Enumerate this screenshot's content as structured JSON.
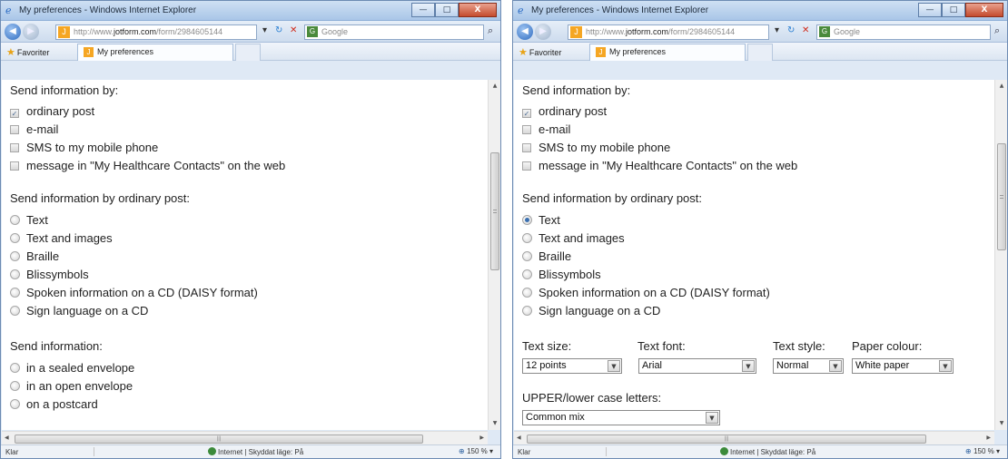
{
  "colors": {
    "titlebar": "#a9c6e8",
    "close": "#c44b2d",
    "checked": "#3a6fb0"
  },
  "left": {
    "window": {
      "title": "My preferences - Windows Internet Explorer",
      "minimize": "—",
      "maximize": "□",
      "close": "X"
    },
    "nav": {
      "url_prefix": "http://www.",
      "url_domain": "jotform.com",
      "url_path": "/form/2984605144",
      "search_placeholder": "Google"
    },
    "favorites_label": "Favoriter",
    "tab_label": "My preferences",
    "send_by": {
      "title": "Send information by:",
      "options": [
        {
          "label": "ordinary post",
          "checked": true
        },
        {
          "label": "e-mail",
          "checked": false
        },
        {
          "label": "SMS to my mobile phone",
          "checked": false
        },
        {
          "label": "message in \"My Healthcare Contacts\" on the web",
          "checked": false
        }
      ]
    },
    "post_format": {
      "title": "Send information by ordinary post:",
      "options": [
        {
          "label": "Text",
          "selected": false
        },
        {
          "label": "Text and images",
          "selected": false
        },
        {
          "label": "Braille",
          "selected": false
        },
        {
          "label": "Blissymbols",
          "selected": false
        },
        {
          "label": "Spoken information on a CD (DAISY format)",
          "selected": false
        },
        {
          "label": "Sign language on a CD",
          "selected": false
        }
      ]
    },
    "envelope": {
      "title": "Send information:",
      "options": [
        {
          "label": "in a sealed envelope",
          "selected": false
        },
        {
          "label": "in an open envelope",
          "selected": false
        },
        {
          "label": "on a postcard",
          "selected": false
        }
      ]
    },
    "status": {
      "left": "Klar",
      "zone": "Internet | Skyddat läge: På",
      "zoom": "150 %"
    }
  },
  "right": {
    "window": {
      "title": "My preferences - Windows Internet Explorer",
      "minimize": "—",
      "maximize": "□",
      "close": "X"
    },
    "nav": {
      "url_prefix": "http://www.",
      "url_domain": "jotform.com",
      "url_path": "/form/2984605144",
      "search_placeholder": "Google"
    },
    "favorites_label": "Favoriter",
    "tab_label": "My preferences",
    "send_by": {
      "title": "Send information by:",
      "options": [
        {
          "label": "ordinary post",
          "checked": true
        },
        {
          "label": "e-mail",
          "checked": false
        },
        {
          "label": "SMS to my mobile phone",
          "checked": false
        },
        {
          "label": "message in \"My Healthcare Contacts\" on the web",
          "checked": false
        }
      ]
    },
    "post_format": {
      "title": "Send information by ordinary post:",
      "options": [
        {
          "label": "Text",
          "selected": true
        },
        {
          "label": "Text and images",
          "selected": false
        },
        {
          "label": "Braille",
          "selected": false
        },
        {
          "label": "Blissymbols",
          "selected": false
        },
        {
          "label": "Spoken information on a CD (DAISY format)",
          "selected": false
        },
        {
          "label": "Sign language on a CD",
          "selected": false
        }
      ]
    },
    "text_format": {
      "size_label": "Text size:",
      "size_value": "12 points",
      "font_label": "Text font:",
      "font_value": "Arial",
      "style_label": "Text style:",
      "style_value": "Normal",
      "paper_label": "Paper colour:",
      "paper_value": "White paper"
    },
    "case": {
      "label": "UPPER/lower case letters:",
      "value": "Common mix"
    },
    "status": {
      "left": "Klar",
      "zone": "Internet | Skyddat läge: På",
      "zoom": "150 %"
    }
  }
}
